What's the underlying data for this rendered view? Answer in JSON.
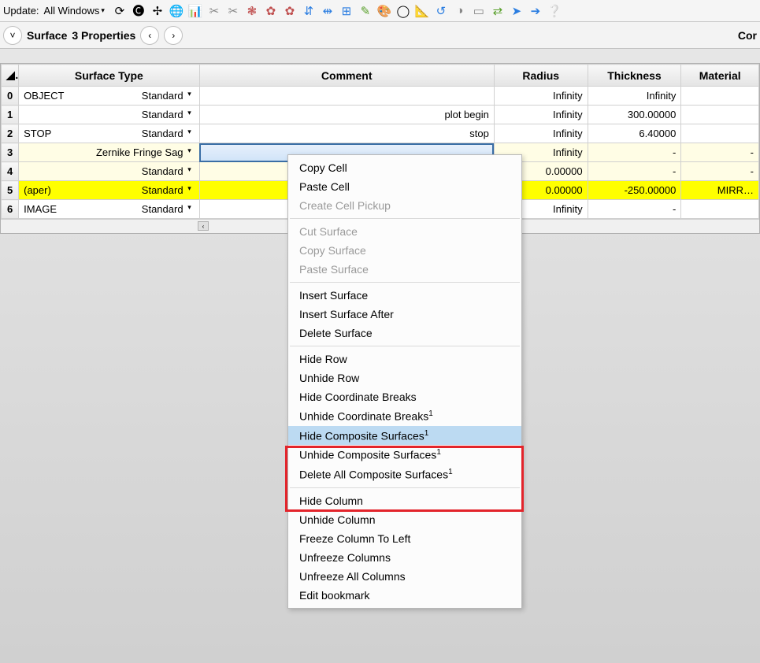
{
  "toolbar": {
    "update_label": "Update:",
    "update_value": "All Windows",
    "icons": [
      {
        "name": "refresh",
        "glyph": "⟳",
        "color": "#000"
      },
      {
        "name": "refresh-all",
        "glyph": "🅒",
        "color": "#000"
      },
      {
        "name": "move",
        "glyph": "✢",
        "color": "#000"
      },
      {
        "name": "globe",
        "glyph": "🌐",
        "color": "#2a7de1"
      },
      {
        "name": "chart",
        "glyph": "📊",
        "color": "#5aa02c"
      },
      {
        "name": "cut-v",
        "glyph": "✂",
        "color": "#888"
      },
      {
        "name": "cut-h",
        "glyph": "✂",
        "color": "#888"
      },
      {
        "name": "paste",
        "glyph": "❃",
        "color": "#c05050"
      },
      {
        "name": "gear-a",
        "glyph": "✿",
        "color": "#c05050"
      },
      {
        "name": "gear-b",
        "glyph": "✿",
        "color": "#c05050"
      },
      {
        "name": "align-v",
        "glyph": "⇵",
        "color": "#2a7de1"
      },
      {
        "name": "split-h",
        "glyph": "⇹",
        "color": "#2a7de1"
      },
      {
        "name": "grid",
        "glyph": "⊞",
        "color": "#2a7de1"
      },
      {
        "name": "wand",
        "glyph": "✎",
        "color": "#5aa02c"
      },
      {
        "name": "palette",
        "glyph": "🎨",
        "color": "#5aa02c"
      },
      {
        "name": "ring",
        "glyph": "◯",
        "color": "#000"
      },
      {
        "name": "slope",
        "glyph": "📐",
        "color": "#c08000"
      },
      {
        "name": "loop",
        "glyph": "↺",
        "color": "#2a7de1"
      },
      {
        "name": "toggle",
        "glyph": "◑",
        "color": "#888"
      },
      {
        "name": "doc",
        "glyph": "▭",
        "color": "#888"
      },
      {
        "name": "swap",
        "glyph": "⇄",
        "color": "#5aa02c"
      },
      {
        "name": "step-right",
        "glyph": "➤",
        "color": "#2a7de1"
      },
      {
        "name": "arrow-right",
        "glyph": "➔",
        "color": "#2a7de1"
      },
      {
        "name": "help",
        "glyph": "❔",
        "color": "#2a7de1"
      }
    ]
  },
  "subbar": {
    "title": "Surface",
    "subtitle": "3 Properties",
    "right": "Cor"
  },
  "columns": {
    "stype": "Surface Type",
    "comment": "Comment",
    "radius": "Radius",
    "thickness": "Thickness",
    "material": "Material"
  },
  "rows": [
    {
      "n": "0",
      "label": "OBJECT",
      "name": "Standard",
      "comment": "",
      "radius": "Infinity",
      "thick": "Infinity",
      "mat": "",
      "cls": ""
    },
    {
      "n": "1",
      "label": "",
      "name": "Standard",
      "comment": "plot begin",
      "radius": "Infinity",
      "thick": "300.00000",
      "mat": "",
      "cls": ""
    },
    {
      "n": "2",
      "label": "STOP",
      "name": "Standard",
      "comment": "stop",
      "radius": "Infinity",
      "thick": "6.40000",
      "mat": "",
      "cls": ""
    },
    {
      "n": "3",
      "label": "",
      "name": "Zernike Fringe Sag",
      "comment": "",
      "radius": "Infinity",
      "thick": "-",
      "mat": "-",
      "cls": "row-lightyellow",
      "selected": true
    },
    {
      "n": "4",
      "label": "",
      "name": "Standard",
      "comment": "",
      "radius": "0.00000",
      "thick": "-",
      "mat": "-",
      "cls": "row-lightyellow"
    },
    {
      "n": "5",
      "label": "(aper)",
      "name": "Standard",
      "comment": "",
      "radius": "0.00000",
      "thick": "-250.00000",
      "mat": "MIRR…",
      "cls": "row-yellow"
    },
    {
      "n": "6",
      "label": "IMAGE",
      "name": "Standard",
      "comment": "",
      "radius": "Infinity",
      "thick": "-",
      "mat": "",
      "cls": ""
    }
  ],
  "ctx": {
    "groups": [
      [
        {
          "label": "Copy Cell",
          "disabled": false
        },
        {
          "label": "Paste Cell",
          "disabled": false
        },
        {
          "label": "Create Cell Pickup",
          "disabled": true
        }
      ],
      [
        {
          "label": "Cut Surface",
          "disabled": true
        },
        {
          "label": "Copy Surface",
          "disabled": true
        },
        {
          "label": "Paste Surface",
          "disabled": true
        }
      ],
      [
        {
          "label": "Insert Surface",
          "disabled": false
        },
        {
          "label": "Insert Surface After",
          "disabled": false
        },
        {
          "label": "Delete Surface",
          "disabled": false
        }
      ],
      [
        {
          "label": "Hide Row",
          "disabled": false
        },
        {
          "label": "Unhide Row",
          "disabled": false
        },
        {
          "label": "Hide Coordinate Breaks",
          "disabled": false
        },
        {
          "label": "Unhide Coordinate Breaks¹",
          "disabled": false
        },
        {
          "label": "Hide Composite Surfaces¹",
          "disabled": false,
          "highlight": true
        },
        {
          "label": "Unhide Composite Surfaces¹",
          "disabled": false
        },
        {
          "label": "Delete All Composite Surfaces¹",
          "disabled": false
        }
      ],
      [
        {
          "label": "Hide Column",
          "disabled": false
        },
        {
          "label": "Unhide Column",
          "disabled": false
        },
        {
          "label": "Freeze Column To Left",
          "disabled": false
        },
        {
          "label": "Unfreeze Columns",
          "disabled": false
        },
        {
          "label": "Unfreeze All Columns",
          "disabled": false
        },
        {
          "label": "Edit bookmark",
          "disabled": false
        }
      ]
    ]
  }
}
